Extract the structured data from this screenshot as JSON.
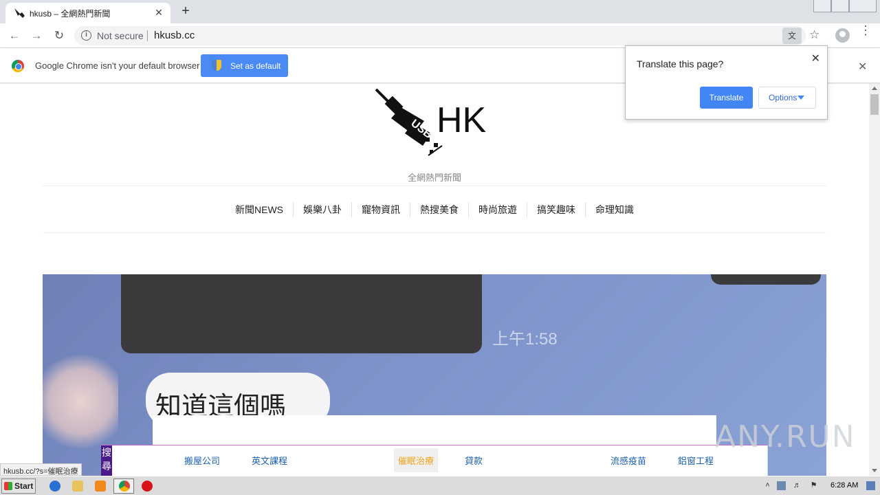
{
  "browser": {
    "tab_title": "hkusb – 全網熱門新聞",
    "tab_close": "✕",
    "new_tab": "+",
    "address": {
      "security_label": "Not secure",
      "url": "hkusb.cc"
    }
  },
  "infobar": {
    "message": "Google Chrome isn't your default browser",
    "button_label": "Set as default"
  },
  "translate_popup": {
    "question": "Translate this page?",
    "translate_label": "Translate",
    "options_label": "Options"
  },
  "site": {
    "logo_text": "HK",
    "tagline": "全網熱門新聞",
    "nav": [
      "新聞NEWS",
      "娛樂八卦",
      "寵物資訊",
      "熱搜美食",
      "時尚旅遊",
      "搞笑趣味",
      "命理知識"
    ],
    "hero": {
      "time_text": "上午1:58",
      "bubble_text": "知道這個嗎"
    },
    "tag_bar": {
      "search_label": "搜尋",
      "tags": [
        "搬屋公司",
        "英文課程",
        "催眠治療",
        "貸款",
        "流感疫苗",
        "鋁窗工程"
      ],
      "active_tag": "催眠治療"
    }
  },
  "status_url": "hkusb.cc/?s=催眠治療",
  "watermark": "ANY.RUN",
  "taskbar": {
    "start_label": "Start",
    "clock": "6:28 AM"
  },
  "colors": {
    "accent": "#4285f4",
    "tag_link": "#1a5fa8",
    "tag_active": "#f3a21a"
  }
}
